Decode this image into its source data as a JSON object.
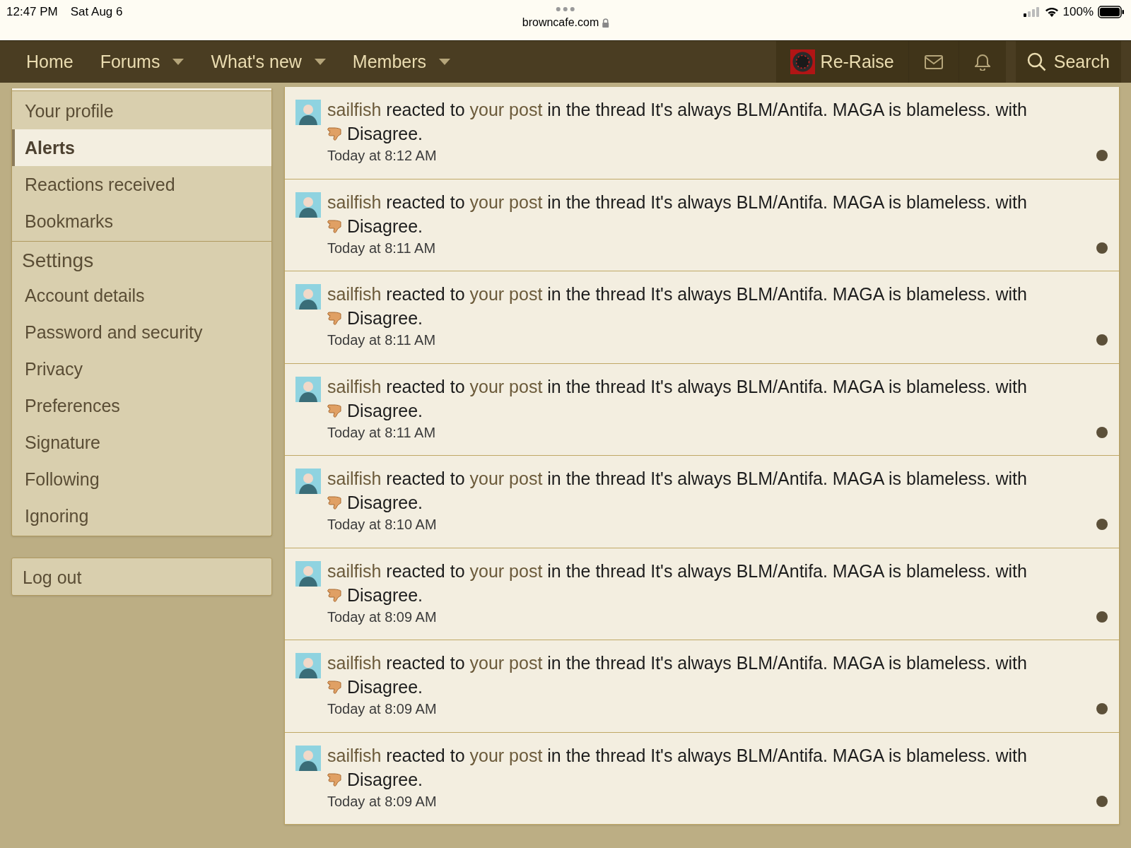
{
  "status_bar": {
    "time": "12:47 PM",
    "date": "Sat Aug 6",
    "url": "browncafe.com",
    "battery": "100%"
  },
  "nav": {
    "items": [
      {
        "label": "Home",
        "dropdown": false
      },
      {
        "label": "Forums",
        "dropdown": true
      },
      {
        "label": "What's new",
        "dropdown": true
      },
      {
        "label": "Members",
        "dropdown": true
      }
    ],
    "account": "Re-Raise",
    "search": "Search"
  },
  "sidebar": {
    "sections": [
      {
        "items": [
          {
            "label": "Your profile",
            "selected": false
          },
          {
            "label": "Alerts",
            "selected": true
          },
          {
            "label": "Reactions received",
            "selected": false
          },
          {
            "label": "Bookmarks",
            "selected": false
          }
        ]
      },
      {
        "heading": "Settings",
        "items": [
          {
            "label": "Account details",
            "selected": false
          },
          {
            "label": "Password and security",
            "selected": false
          },
          {
            "label": "Privacy",
            "selected": false
          },
          {
            "label": "Preferences",
            "selected": false
          },
          {
            "label": "Signature",
            "selected": false
          },
          {
            "label": "Following",
            "selected": false
          },
          {
            "label": "Ignoring",
            "selected": false
          }
        ]
      }
    ],
    "logout": "Log out"
  },
  "alerts": [
    {
      "user": "sailfish",
      "verb": "reacted to",
      "link": "your post",
      "rest": "in the thread It's always BLM/Antifa. MAGA is blameless. with",
      "reaction": "Disagree.",
      "time": "Today at 8:12 AM",
      "unread": true
    },
    {
      "user": "sailfish",
      "verb": "reacted to",
      "link": "your post",
      "rest": "in the thread It's always BLM/Antifa. MAGA is blameless. with",
      "reaction": "Disagree.",
      "time": "Today at 8:11 AM",
      "unread": true
    },
    {
      "user": "sailfish",
      "verb": "reacted to",
      "link": "your post",
      "rest": "in the thread It's always BLM/Antifa. MAGA is blameless. with",
      "reaction": "Disagree.",
      "time": "Today at 8:11 AM",
      "unread": true
    },
    {
      "user": "sailfish",
      "verb": "reacted to",
      "link": "your post",
      "rest": "in the thread It's always BLM/Antifa. MAGA is blameless. with",
      "reaction": "Disagree.",
      "time": "Today at 8:11 AM",
      "unread": true
    },
    {
      "user": "sailfish",
      "verb": "reacted to",
      "link": "your post",
      "rest": "in the thread It's always BLM/Antifa. MAGA is blameless. with",
      "reaction": "Disagree.",
      "time": "Today at 8:10 AM",
      "unread": true
    },
    {
      "user": "sailfish",
      "verb": "reacted to",
      "link": "your post",
      "rest": "in the thread It's always BLM/Antifa. MAGA is blameless. with",
      "reaction": "Disagree.",
      "time": "Today at 8:09 AM",
      "unread": true
    },
    {
      "user": "sailfish",
      "verb": "reacted to",
      "link": "your post",
      "rest": "in the thread It's always BLM/Antifa. MAGA is blameless. with",
      "reaction": "Disagree.",
      "time": "Today at 8:09 AM",
      "unread": true
    },
    {
      "user": "sailfish",
      "verb": "reacted to",
      "link": "your post",
      "rest": "in the thread It's always BLM/Antifa. MAGA is blameless. with",
      "reaction": "Disagree.",
      "time": "Today at 8:09 AM",
      "unread": true
    }
  ]
}
